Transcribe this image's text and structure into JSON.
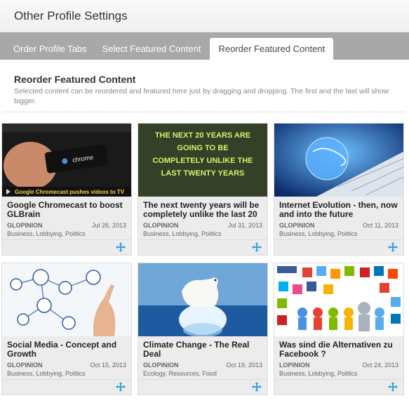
{
  "header": {
    "title": "Other Profile Settings"
  },
  "tabs": [
    {
      "label": "Order Profile Tabs"
    },
    {
      "label": "Select Featured Content"
    },
    {
      "label": "Reorder Featured Content"
    }
  ],
  "section": {
    "heading": "Reorder Featured Content",
    "description": "Selected content can be reordered and featured here just by dragging and dropping. The first and the last will show bigger."
  },
  "cards": [
    {
      "title": "Google Chromecast to boost GLBrain",
      "author": "GLOPINION",
      "date": "Jul 26, 2013",
      "categories": "Business, Lobbying, Politics",
      "thumb_caption": "Google Chromecast pushes videos to TV",
      "thumb_logo": "chrome"
    },
    {
      "title": "The next twenty years will be completely unlike the last 20",
      "author": "GLOPINION",
      "date": "Jul 31, 2013",
      "categories": "Business, Lobbying, Politics",
      "thumb_text": "THE NEXT 20 YEARS ARE GOING TO BE COMPLETELY UNLIKE THE LAST TWENTY YEARS"
    },
    {
      "title": "Internet Evolution - then, now and into the future",
      "author": "GLOPINION",
      "date": "Oct 11, 2013",
      "categories": "Business, Lobbying, Politics"
    },
    {
      "title": "Social Media - Concept and Growth",
      "author": "GLOPINION",
      "date": "Oct 15, 2013",
      "categories": "Business, Lobbying, Politics"
    },
    {
      "title": "Climate Change - The Real Deal",
      "author": "GLOPINION",
      "date": "Oct 19, 2013",
      "categories": "Ecology, Resources, Food"
    },
    {
      "title": "Was sind die Alternativen zu Facebook ?",
      "author": "LOPINION",
      "date": "Oct 24, 2013",
      "categories": "Business, Lobbying, Politics"
    }
  ],
  "colors": {
    "tabbar": "#a8a8a8",
    "move_icon": "#3aa0e0"
  },
  "icons": {
    "drag": "move-icon"
  }
}
